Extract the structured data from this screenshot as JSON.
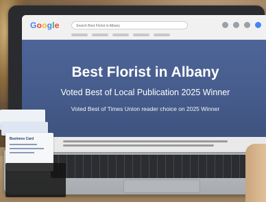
{
  "scene": "laptop on desk displaying a search result page",
  "browser": {
    "logo": [
      "G",
      "o",
      "o",
      "g",
      "l",
      "e"
    ],
    "search_text": "Search Best Florist in Albany"
  },
  "page": {
    "title": "Best Florist in Albany",
    "subtitle": "Voted Best of Local Publication 2025 Winner",
    "line3": "Voted Best of Times Union reader choice on 2025 Winner"
  },
  "cards": {
    "front_label": "Business Card"
  },
  "colors": {
    "hero_bg": "#4e6598",
    "laptop_body": "#2a2b2e",
    "text": "#ffffff"
  }
}
